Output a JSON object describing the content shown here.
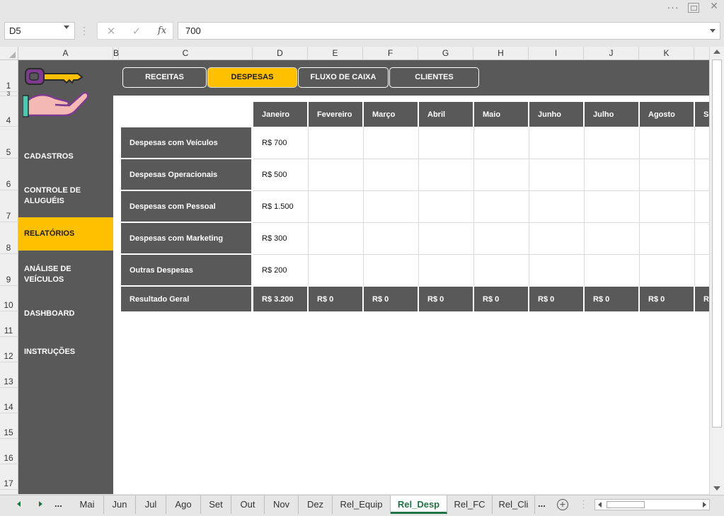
{
  "window": {
    "more_label": "···",
    "close_label": "✕"
  },
  "formula_bar": {
    "name_box": "D5",
    "formula": "700",
    "fx_label": "fx",
    "cancel_label": "✕",
    "enter_label": "✓"
  },
  "columns": [
    "A",
    "B",
    "C",
    "D",
    "E",
    "F",
    "G",
    "H",
    "I",
    "J",
    "K"
  ],
  "rows": [
    "1",
    "3",
    "4",
    "5",
    "6",
    "7",
    "8",
    "9",
    "10",
    "11",
    "12",
    "13",
    "14",
    "15",
    "16",
    "17"
  ],
  "sidebar": {
    "items": [
      {
        "label": "CADASTROS",
        "active": false
      },
      {
        "label": "CONTROLE DE ALUGUÉIS",
        "active": false
      },
      {
        "label": "RELATÓRIOS",
        "active": true
      },
      {
        "label": "ANÁLISE DE VEÍCULOS",
        "active": false
      },
      {
        "label": "DASHBOARD",
        "active": false
      },
      {
        "label": "INSTRUÇÕES",
        "active": false
      }
    ]
  },
  "nav": {
    "buttons": [
      {
        "label": "RECEITAS",
        "active": false
      },
      {
        "label": "DESPESAS",
        "active": true
      },
      {
        "label": "FLUXO DE CAIXA",
        "active": false
      },
      {
        "label": "CLIENTES",
        "active": false
      }
    ]
  },
  "table": {
    "months": [
      "Janeiro",
      "Fevereiro",
      "Março",
      "Abril",
      "Maio",
      "Junho",
      "Julho",
      "Agosto",
      "Se"
    ],
    "rows": [
      {
        "label": "Despesas com Veículos",
        "values": [
          "R$ 700",
          "",
          "",
          "",
          "",
          "",
          "",
          "",
          ""
        ]
      },
      {
        "label": "Despesas Operacionais",
        "values": [
          "R$ 500",
          "",
          "",
          "",
          "",
          "",
          "",
          "",
          ""
        ]
      },
      {
        "label": "Despesas com Pessoal",
        "values": [
          "R$ 1.500",
          "",
          "",
          "",
          "",
          "",
          "",
          "",
          ""
        ]
      },
      {
        "label": "Despesas com Marketing",
        "values": [
          "R$ 300",
          "",
          "",
          "",
          "",
          "",
          "",
          "",
          ""
        ]
      },
      {
        "label": "Outras Despesas",
        "values": [
          "R$ 200",
          "",
          "",
          "",
          "",
          "",
          "",
          "",
          ""
        ]
      }
    ],
    "total": {
      "label": "Resultado Geral",
      "values": [
        "R$ 3.200",
        "R$ 0",
        "R$ 0",
        "R$ 0",
        "R$ 0",
        "R$ 0",
        "R$ 0",
        "R$ 0",
        "R"
      ]
    }
  },
  "sheet_tabs": {
    "more_left": "...",
    "more_right": "...",
    "add_label": "+",
    "tabs": [
      {
        "label": "Mai",
        "active": false
      },
      {
        "label": "Jun",
        "active": false
      },
      {
        "label": "Jul",
        "active": false
      },
      {
        "label": "Ago",
        "active": false
      },
      {
        "label": "Set",
        "active": false
      },
      {
        "label": "Out",
        "active": false
      },
      {
        "label": "Nov",
        "active": false
      },
      {
        "label": "Dez",
        "active": false
      },
      {
        "label": "Rel_Equip",
        "active": false
      },
      {
        "label": "Rel_Desp",
        "active": true
      },
      {
        "label": "Rel_FC",
        "active": false
      },
      {
        "label": "Rel_Cli",
        "active": false
      }
    ]
  },
  "colors": {
    "panel": "#595959",
    "accent": "#ffc000",
    "excel_green": "#217346"
  }
}
